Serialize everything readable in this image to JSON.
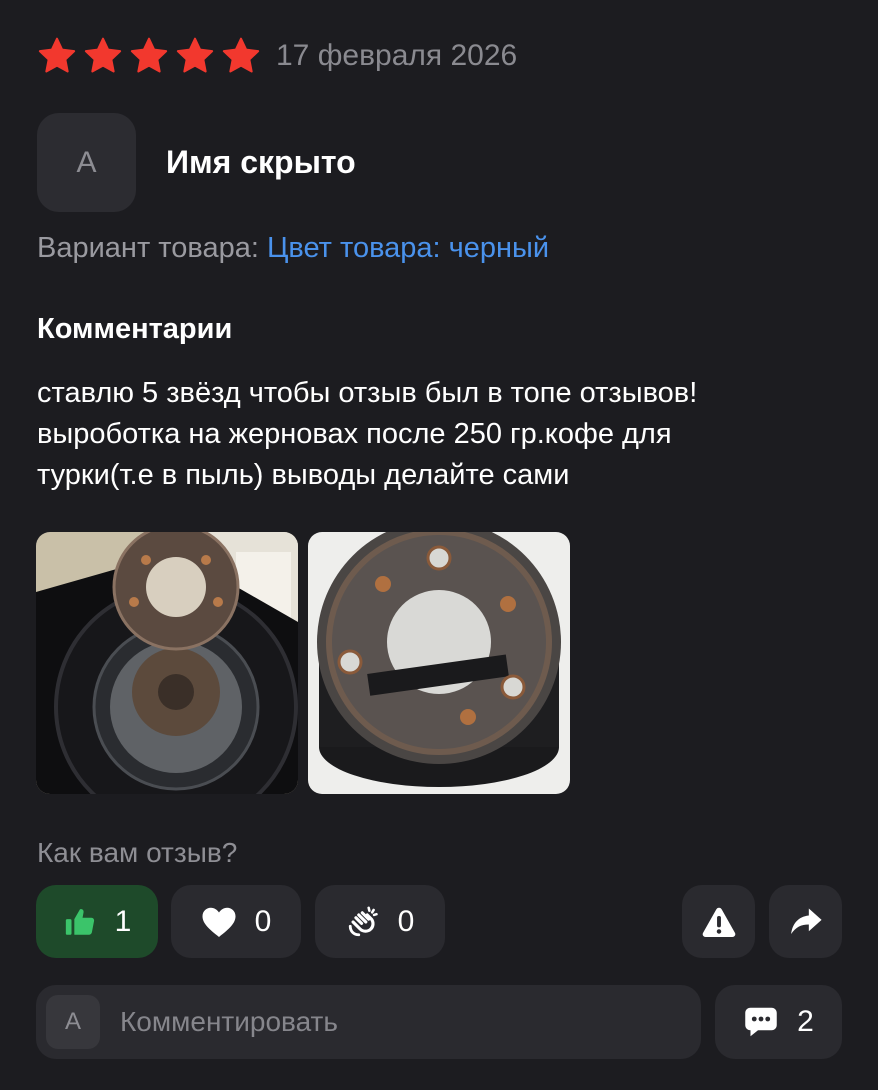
{
  "review": {
    "stars": 5,
    "star_color": "#f2382e",
    "date": "17 февраля 2026",
    "author_initial": "А",
    "author_name": "Имя скрыто",
    "variant_label": "Вариант товара:",
    "variant_value": "Цвет товара: черный",
    "comments_title": "Комментарии",
    "comment_lines": [
      "ставлю 5 звёзд чтобы отзыв был в топе отзывов!",
      "выроботка на жерновах после 250 гр.кофе для",
      "турки(т.е  в пыль) выводы делайте сами"
    ]
  },
  "photos": [
    {
      "icon": "coffee-grinder-burr-photo-1"
    },
    {
      "icon": "coffee-grinder-burr-photo-2"
    }
  ],
  "feedback": {
    "question": "Как вам отзыв?",
    "like_count": "1",
    "heart_count": "0",
    "clap_count": "0",
    "like_accent": "#3bc46a",
    "like_bg": "#1e4a2a"
  },
  "comment_box": {
    "avatar_initial": "А",
    "placeholder": "Комментировать",
    "count": "2"
  }
}
